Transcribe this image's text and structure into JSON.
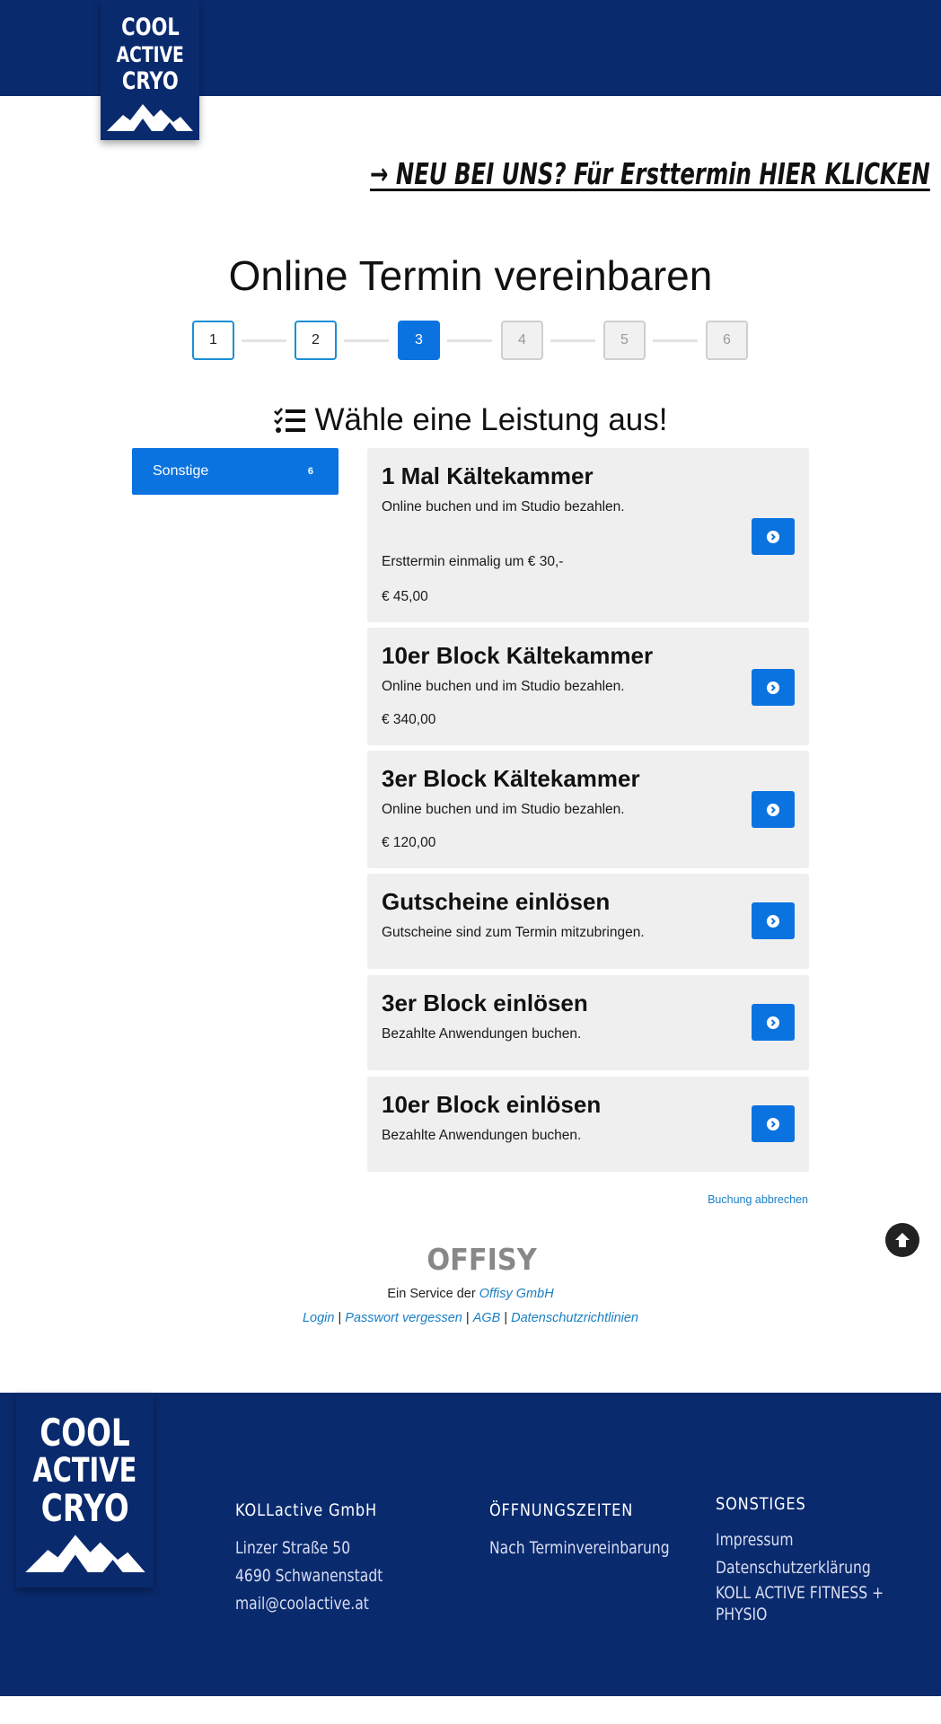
{
  "brand": {
    "logo_lines": [
      "COOL",
      "ACTIVE",
      "CRYO"
    ],
    "primary_color": "#0a2a6e",
    "accent_color": "#0b73e0",
    "link_color": "#1a7fc4"
  },
  "header": {
    "new_customer_link": "→ NEU BEI UNS? Für Ersttermin HIER KLICKEN"
  },
  "page_title": "Online Termin vereinbaren",
  "stepper": {
    "steps": [
      "1",
      "2",
      "3",
      "4",
      "5",
      "6"
    ],
    "active_step": 3
  },
  "section_title": "Wähle eine Leistung aus!",
  "section_icon": "checklist-icon",
  "categories": [
    {
      "label": "Sonstige",
      "count": "6"
    }
  ],
  "services": [
    {
      "title": "1 Mal Kältekammer",
      "description": "Online buchen und im Studio bezahlen.",
      "extra": "Ersttermin einmalig um € 30,-",
      "price": "€ 45,00"
    },
    {
      "title": "10er Block Kältekammer",
      "description": "Online buchen und im Studio bezahlen.",
      "price": "€ 340,00"
    },
    {
      "title": "3er Block Kältekammer",
      "description": "Online buchen und im Studio bezahlen.",
      "price": "€ 120,00"
    },
    {
      "title": "Gutscheine einlösen",
      "description": "Gutscheine sind zum Termin mitzubringen."
    },
    {
      "title": "3er Block einlösen",
      "description": "Bezahlte Anwendungen buchen."
    },
    {
      "title": "10er Block einlösen",
      "description": "Bezahlte Anwendungen buchen."
    }
  ],
  "cancel_link": "Buchung abbrechen",
  "provider": {
    "logo_text": "OFFISY",
    "service_prefix": "Ein Service der",
    "company": "Offisy GmbH",
    "links": [
      "Login",
      "Passwort vergessen",
      "AGB",
      "Datenschutzrichtlinien"
    ],
    "separator": " | "
  },
  "footer": {
    "company": {
      "heading": "KOLLactive GmbH",
      "lines": [
        "Linzer Straße 50",
        "4690 Schwanenstadt",
        "mail@coolactive.at"
      ]
    },
    "hours": {
      "heading": "ÖFFNUNGSZEITEN",
      "lines": [
        "Nach Terminvereinbarung"
      ]
    },
    "misc": {
      "heading": "SONSTIGES",
      "links": [
        "Impressum",
        "Datenschutzerklärung",
        "KOLL ACTIVE FITNESS +",
        "PHYSIO"
      ]
    }
  }
}
